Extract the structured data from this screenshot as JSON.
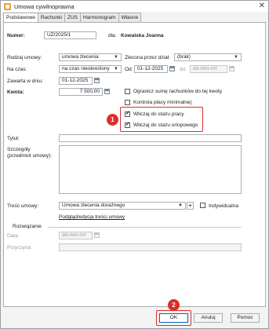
{
  "window": {
    "title": "Umowa cywilnoprawna"
  },
  "tabs": [
    "Podstawowe",
    "Rachunki",
    "ZUS",
    "Harmonogram",
    "Własne"
  ],
  "form": {
    "numer_label": "Numer:",
    "numer_value": "UZ/2025/1",
    "dla_label": "dla:",
    "dla_value": "Kowalska Joanna",
    "rodzaj_label": "Rodzaj umowy:",
    "rodzaj_value": "umowa zlecenia",
    "zlecona_label": "Zlecona przez dział:",
    "zlecona_value": "(brak)",
    "na_czas_label": "Na czas:",
    "na_czas_value": "na czas nieokreślony",
    "od_label": "Od:",
    "od_value": "01-12-2025",
    "do_label": "do:",
    "do_value": "dd-mm-rrrr",
    "zawarta_label": "Zawarta w dniu:",
    "zawarta_value": "01-12-2025",
    "kwota_label": "Kwota:",
    "kwota_value": "7 500,00",
    "ogranicz_label": "Ogranicz sumę rachunków do tej kwoty",
    "kontrola_label": "Kontrola płacy minimalnej",
    "wlicz_pracy_label": "Wliczaj do stażu pracy",
    "wlicz_urlop_label": "Wliczaj do stażu urlopowego",
    "tytul_label": "Tytuł:",
    "tytul_value": "",
    "szczegoly_label_1": "Szczegóły",
    "szczegoly_label_2": "(przedmiot umowy):",
    "tresc_label": "Treść umowy:",
    "tresc_value": "Umowa zlecenia doraźnego",
    "plus": "+",
    "indywidualna_label": "Indywidualna",
    "podglad_link": "Podgląd/edycja treści umowy",
    "rozwiazanie_label": "Rozwiązanie",
    "data_label": "Data:",
    "data_value": "dd-mm-rrrr",
    "przyczyna_label": "Przyczyna:",
    "przyczyna_value": ""
  },
  "checkboxes": {
    "ogranicz": false,
    "kontrola": false,
    "wlicz_pracy": true,
    "wlicz_urlop": true,
    "indywidualna": false
  },
  "annotations": {
    "badge1": "1",
    "badge2": "2",
    "accent": "#d9302c"
  },
  "buttons": {
    "ok": "OK",
    "anuluj": "Anuluj",
    "pomoc": "Pomoc"
  }
}
